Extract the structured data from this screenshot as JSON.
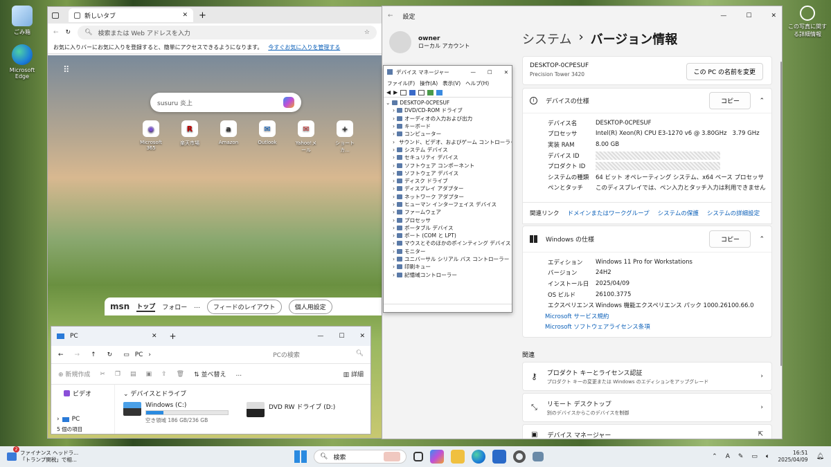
{
  "desktop": {
    "icons": [
      {
        "label": "ごみ箱"
      },
      {
        "label": "Microsoft Edge"
      }
    ],
    "right_icon_label": "この写真に関する詳細情報"
  },
  "edge": {
    "tab_label": "新しいタブ",
    "address_placeholder": "検索または Web アドレスを入力",
    "fav_bar_text": "お気に入りバーにお気に入りを登録すると、簡単にアクセスできるようになります。",
    "fav_bar_link": "今すぐお気に入りを管理する",
    "search_value": "susuru 炎上",
    "quick_links": [
      "Microsoft 365",
      "楽天市場",
      "Amazon",
      "Outlook",
      "Yahoo!メール",
      "ショートカ..."
    ],
    "msn": {
      "brand": "msn",
      "tab_top": "トップ",
      "tab_follow": "フォロー",
      "more": "...",
      "feed_layout": "フィードのレイアウト",
      "personalize": "個人用設定"
    }
  },
  "explorer": {
    "tab_label": "PC",
    "breadcrumb": "PC",
    "search_placeholder": "PCの検索",
    "new_label": "新規作成",
    "sort_label": "並べ替え",
    "more_label": "...",
    "details_label": "詳細",
    "sidebar": [
      "ビデオ",
      "PC"
    ],
    "status": "5 個の項目",
    "section_title": "デバイスとドライブ",
    "drives": [
      {
        "name": "Windows (C:)",
        "space": "空き領域 186 GB/236 GB",
        "used_fraction": 0.21
      },
      {
        "name": "DVD RW ドライブ (D:)"
      }
    ]
  },
  "settings": {
    "window_title": "設定",
    "user_name": "owner",
    "user_type": "ローカル アカウント",
    "breadcrumb_parent": "システム",
    "breadcrumb_sep": "›",
    "page_title": "バージョン情報",
    "pc_name": "DESKTOP-0CPESUF",
    "pc_model": "Precision Tower 3420",
    "rename_button": "この PC の名前を変更",
    "device_spec": {
      "title": "デバイスの仕様",
      "copy": "コピー",
      "rows": [
        {
          "k": "デバイス名",
          "v": "DESKTOP-0CPESUF"
        },
        {
          "k": "プロセッサ",
          "v": "Intel(R) Xeon(R) CPU E3-1270 v6 @ 3.80GHz   3.79 GHz"
        },
        {
          "k": "実装 RAM",
          "v": "8.00 GB"
        },
        {
          "k": "デバイス ID",
          "v": ""
        },
        {
          "k": "プロダクト ID",
          "v": ""
        },
        {
          "k": "システムの種類",
          "v": "64 ビット オペレーティング システム、x64 ベース プロセッサ"
        },
        {
          "k": "ペンとタッチ",
          "v": "このディスプレイでは、ペン入力とタッチ入力は利用できません"
        }
      ]
    },
    "related_links": {
      "label": "関連リンク",
      "links": [
        "ドメインまたはワークグループ",
        "システムの保護",
        "システムの詳細設定"
      ]
    },
    "windows_spec": {
      "title": "Windows の仕様",
      "copy": "コピー",
      "rows": [
        {
          "k": "エディション",
          "v": "Windows 11 Pro for Workstations"
        },
        {
          "k": "バージョン",
          "v": "24H2"
        },
        {
          "k": "インストール日",
          "v": "2025/04/09"
        },
        {
          "k": "OS ビルド",
          "v": "26100.3775"
        },
        {
          "k": "エクスペリエンス",
          "v": "Windows 機能エクスペリエンス パック 1000.26100.66.0"
        }
      ],
      "links": [
        "Microsoft サービス規約",
        "Microsoft ソフトウェアライセンス条項"
      ]
    },
    "related_title": "関連",
    "related_items": [
      {
        "title": "プロダクト キーとライセンス認証",
        "desc": "プロダクト キーの変更または Windows のエディションをアップグレード"
      },
      {
        "title": "リモート デスクトップ",
        "desc": "別のデバイスからこのデバイスを制御"
      },
      {
        "title": "デバイス マネージャー",
        "desc": ""
      }
    ]
  },
  "devmgr": {
    "title": "デバイス マネージャー",
    "menu": [
      "ファイル(F)",
      "操作(A)",
      "表示(V)",
      "ヘルプ(H)"
    ],
    "root": "DESKTOP-0CPESUF",
    "items": [
      "DVD/CD-ROM ドライブ",
      "オーディオの入力および出力",
      "キーボード",
      "コンピューター",
      "サウンド、ビデオ、およびゲーム コントローラー",
      "システム デバイス",
      "セキュリティ デバイス",
      "ソフトウェア コンポーネント",
      "ソフトウェア デバイス",
      "ディスク ドライブ",
      "ディスプレイ アダプター",
      "ネットワーク アダプター",
      "ヒューマン インターフェイス デバイス",
      "ファームウェア",
      "プロセッサ",
      "ポータブル デバイス",
      "ポート (COM と LPT)",
      "マウスとそのほかのポインティング デバイス",
      "モニター",
      "ユニバーサル シリアル バス コントローラー",
      "印刷キュー",
      "記憶域コントローラー"
    ]
  },
  "taskbar": {
    "news_title": "ファイナンス ヘッドラ...",
    "news_sub": "「トランプ関税」で相...",
    "news_badge": "2",
    "search_label": "検索",
    "ime": "A",
    "time": "16:51",
    "date": "2025/04/09"
  }
}
